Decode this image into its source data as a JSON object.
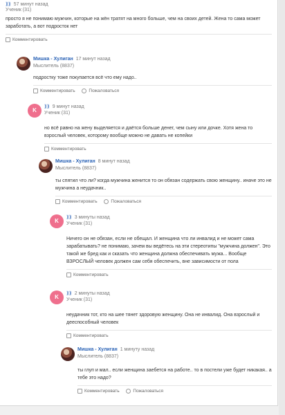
{
  "comments": [
    {
      "author": "⟫⟫",
      "time": "57 минут назад",
      "rank": "Ученик (31)",
      "text": "просто я не понимаю мужчин, которые на жён тратят на много больше, чем на своих детей. Жена то сама может заработать, а вот подросток нет",
      "actions": [
        "Комментировать"
      ]
    },
    {
      "author": "Мишка - Хулиган",
      "time": "17 минут назад",
      "rank": "Мыслитель (8837)",
      "text": "подростку тоже покупается всё что ему надо..",
      "actions": [
        "Комментировать",
        "Пожаловаться"
      ]
    },
    {
      "author": "⟫⟫",
      "time": "9 минут назад",
      "rank": "Ученик (31)",
      "text": "но всё равно на жену выделяется и даётся больше денег, чем сыну или дочке. Хотя жена то взрослый человек, которому вообще можно не давать не копейки",
      "actions": [
        "Комментировать"
      ]
    },
    {
      "author": "Мишка - Хулиган",
      "time": "8 минут назад",
      "rank": "Мыслитель (8837)",
      "text": "ты спятил что ли? когда мужчина женится то он обязан содержать свою женщину.. иначе это не мужчина а неудачник..",
      "actions": [
        "Комментировать",
        "Пожаловаться"
      ]
    },
    {
      "author": "⟫⟫",
      "time": "3 минуты назад",
      "rank": "Ученик (31)",
      "text": "Ничего он не обязан, если не обещал. И женщина что ли инвалид и не может сама зарабатывать? не понимаю, зачем вы ведётесь на эти стереотипы \"мужчина должен\". Это такой же бред как и сказать что женщина должна обеспечивать мужа... Вообще ВЗРОСЛЫЙ человек должен сам себя обеспечить, вне зависимости от пола",
      "actions": [
        "Комментировать"
      ]
    },
    {
      "author": "⟫⟫",
      "time": "2 минуты назад",
      "rank": "Ученик (31)",
      "text": "неудачник тот, кто на шее тянет здоровую женщину. Она не инвалид. Она взрослый и дееспособный человек",
      "actions": [
        "Комментировать"
      ]
    },
    {
      "author": "Мишка - Хулиган",
      "time": "1 минуту назад",
      "rank": "Мыслитель (8837)",
      "text": "ты глуп и мал.. если женщина заебется на работе.. то в постели уже будет никакая.. а тебе это надо?",
      "actions": [
        "Комментировать",
        "Пожаловаться"
      ]
    }
  ],
  "avatar_letter": "K",
  "colors": {
    "accent": "#ef6f8d",
    "link": "#2b63b6"
  }
}
